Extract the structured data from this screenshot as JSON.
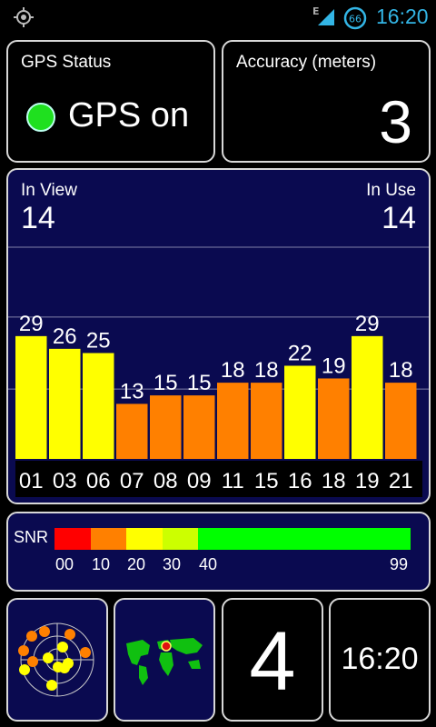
{
  "status_bar": {
    "left_icon": "gps-locate-icon",
    "network_type": "E",
    "signal_icon": "cell-signal-icon",
    "battery_level": "66",
    "time": "16:20"
  },
  "gps_status": {
    "title": "GPS Status",
    "value": "GPS on",
    "indicator_color": "#22e022"
  },
  "accuracy": {
    "title": "Accuracy (meters)",
    "value": "3"
  },
  "satellites": {
    "in_view_label": "In View",
    "in_view_value": "14",
    "in_use_label": "In Use",
    "in_use_value": "14"
  },
  "chart_data": {
    "type": "bar",
    "categories": [
      "01",
      "03",
      "06",
      "07",
      "08",
      "09",
      "11",
      "15",
      "16",
      "18",
      "19",
      "21"
    ],
    "values": [
      29,
      26,
      25,
      13,
      15,
      15,
      18,
      18,
      22,
      19,
      29,
      18
    ],
    "ylim": [
      0,
      50
    ],
    "colors": {
      "high": "#ffff00",
      "mid": "#ff8000",
      "threshold": 20
    }
  },
  "snr": {
    "label": "SNR",
    "ticks": [
      "00",
      "10",
      "20",
      "30",
      "40",
      "99"
    ],
    "segments": [
      {
        "color": "#ff0000",
        "value": 10
      },
      {
        "color": "#ff8000",
        "value": 10
      },
      {
        "color": "#ffff00",
        "value": 10
      },
      {
        "color": "#ccff00",
        "value": 10
      },
      {
        "color": "#00ff00",
        "value": 59
      }
    ]
  },
  "tiles": {
    "skyplot_icon": "sky-plot-icon",
    "worldmap_icon": "world-map-icon",
    "satellite_count": "4",
    "time": "16:20"
  }
}
